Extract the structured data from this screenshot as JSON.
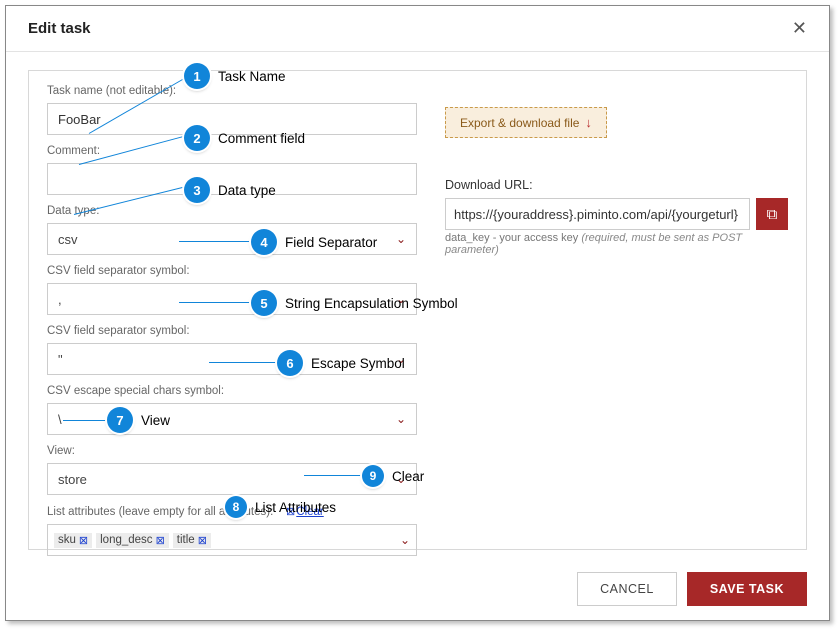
{
  "header": {
    "title": "Edit task"
  },
  "left": {
    "taskname_label": "Task name (not editable):",
    "taskname_value": "FooBar",
    "comment_label": "Comment:",
    "comment_value": "",
    "datatype_label": "Data type:",
    "datatype_value": "csv",
    "fieldsep_label": "CSV field separator symbol:",
    "fieldsep_value": ",",
    "encap_label": "CSV field separator symbol:",
    "encap_value": "\"",
    "escape_label": "CSV escape special chars symbol:",
    "escape_value": "\\",
    "view_label": "View:",
    "view_value": "store",
    "listattr_label": "List attributes (leave empty for all attributes):",
    "clear_label": "Clear",
    "attrs": [
      "sku",
      "long_desc",
      "title"
    ]
  },
  "right": {
    "export_label": "Export & download file",
    "url_label": "Download URL:",
    "url_value": "https://{youraddress}.piminto.com/api/{yourgeturl}",
    "hint_prefix": "data_key - your access key ",
    "hint_italic": "(required, must be sent as POST parameter)"
  },
  "footer": {
    "cancel": "CANCEL",
    "save": "SAVE TASK"
  },
  "callouts": {
    "c1": "Task Name",
    "c2": "Comment field",
    "c3": "Data type",
    "c4": "Field Separator",
    "c5": "String Encapsulation Symbol",
    "c6": "Escape Symbol",
    "c7": "View",
    "c8": "List Attributes",
    "c9": "Clear"
  }
}
